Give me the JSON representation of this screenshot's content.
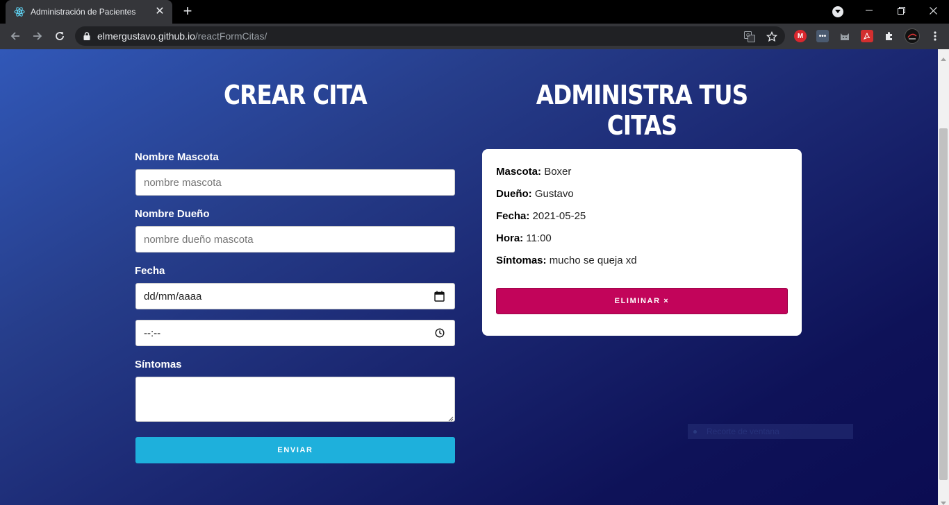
{
  "browser": {
    "tab_title": "Administración de Pacientes",
    "tab_close": "✕",
    "new_tab": "+",
    "url_host": "elmergustavo.github.io",
    "url_path": "/reactFormCitas/",
    "extension_icons": [
      "mega-icon",
      "more-dots-extension-icon",
      "cat-extension-icon",
      "pdf-extension-icon",
      "puzzle-icon",
      "profile-avatar"
    ],
    "brand_colors": {
      "mega": "#d9272e",
      "pdf": "#d32f2f"
    }
  },
  "page": {
    "create_heading": "CREAR CITA",
    "manage_heading": "ADMINISTRA TUS CITAS",
    "form": {
      "pet_label": "Nombre Mascota",
      "pet_placeholder": "nombre mascota",
      "owner_label": "Nombre Dueño",
      "owner_placeholder": "nombre dueño mascota",
      "date_label": "Fecha",
      "date_value": "dd/mm/aaaa",
      "time_value": "--:--",
      "symptoms_label": "Síntomas",
      "symptoms_value": "",
      "submit_label": "ENVIAR"
    },
    "appointment": {
      "pet_key": "Mascota:",
      "pet_value": "Boxer",
      "owner_key": "Dueño:",
      "owner_value": "Gustavo",
      "date_key": "Fecha:",
      "date_value": "2021-05-25",
      "time_key": "Hora:",
      "time_value": "11:00",
      "symptoms_key": "Síntomas:",
      "symptoms_value": "mucho se queja xd",
      "delete_label": "ELIMINAR ×"
    },
    "overlay_text": "Recorte de ventana",
    "colors": {
      "submit_button": "#1eb0dc",
      "delete_button": "#c2045a",
      "background_start": "#3158b8",
      "background_end": "#0b0c52"
    }
  }
}
